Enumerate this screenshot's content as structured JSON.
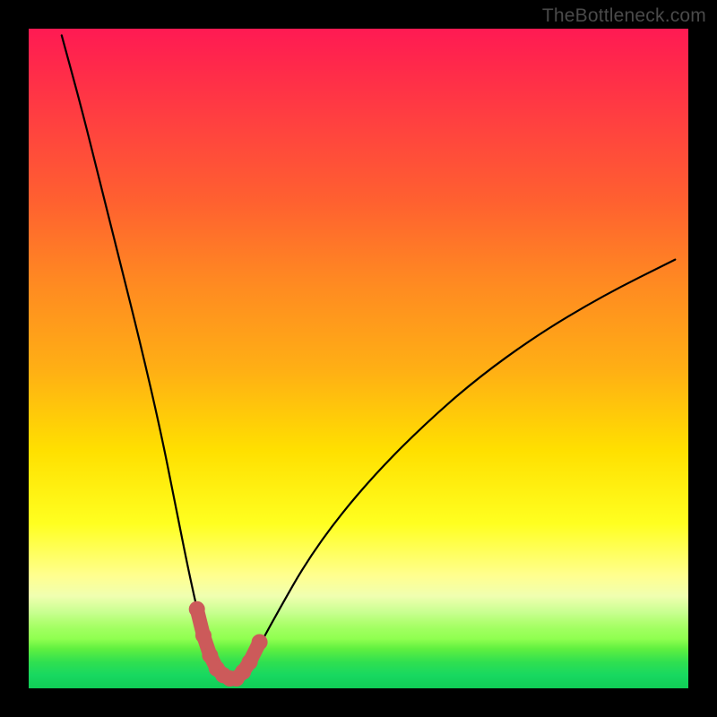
{
  "watermark": "TheBottleneck.com",
  "colors": {
    "frame": "#000000",
    "gradient_top": "#ff1a53",
    "gradient_mid": "#ffe000",
    "gradient_bottom": "#10cc56",
    "curve": "#000000",
    "marker_fill": "#cc5a5a",
    "marker_stroke": "#cc5a5a"
  },
  "chart_data": {
    "type": "line",
    "title": "",
    "xlabel": "",
    "ylabel": "",
    "xlim": [
      0,
      100
    ],
    "ylim": [
      0,
      100
    ],
    "grid": false,
    "series": [
      {
        "name": "bottleneck-curve",
        "x": [
          5,
          8,
          11,
          14,
          17,
          20,
          22,
          24,
          25.5,
          27,
          28.5,
          30,
          31.5,
          33,
          35,
          38,
          42,
          47,
          53,
          60,
          68,
          77,
          87,
          98
        ],
        "y": [
          99,
          88,
          76,
          64,
          52,
          39,
          29,
          19,
          12,
          6.5,
          3,
          1.5,
          1.5,
          3,
          6.5,
          12,
          19,
          26,
          33,
          40,
          47,
          53.5,
          59.5,
          65
        ]
      }
    ],
    "highlighted_points": {
      "name": "trough-markers",
      "x": [
        25.5,
        26.5,
        27.5,
        28.5,
        29.5,
        30.5,
        31.5,
        32.5,
        33.5,
        35
      ],
      "y": [
        12,
        8,
        5,
        3,
        2,
        1.5,
        1.5,
        2.5,
        4,
        7
      ]
    },
    "annotations": []
  }
}
